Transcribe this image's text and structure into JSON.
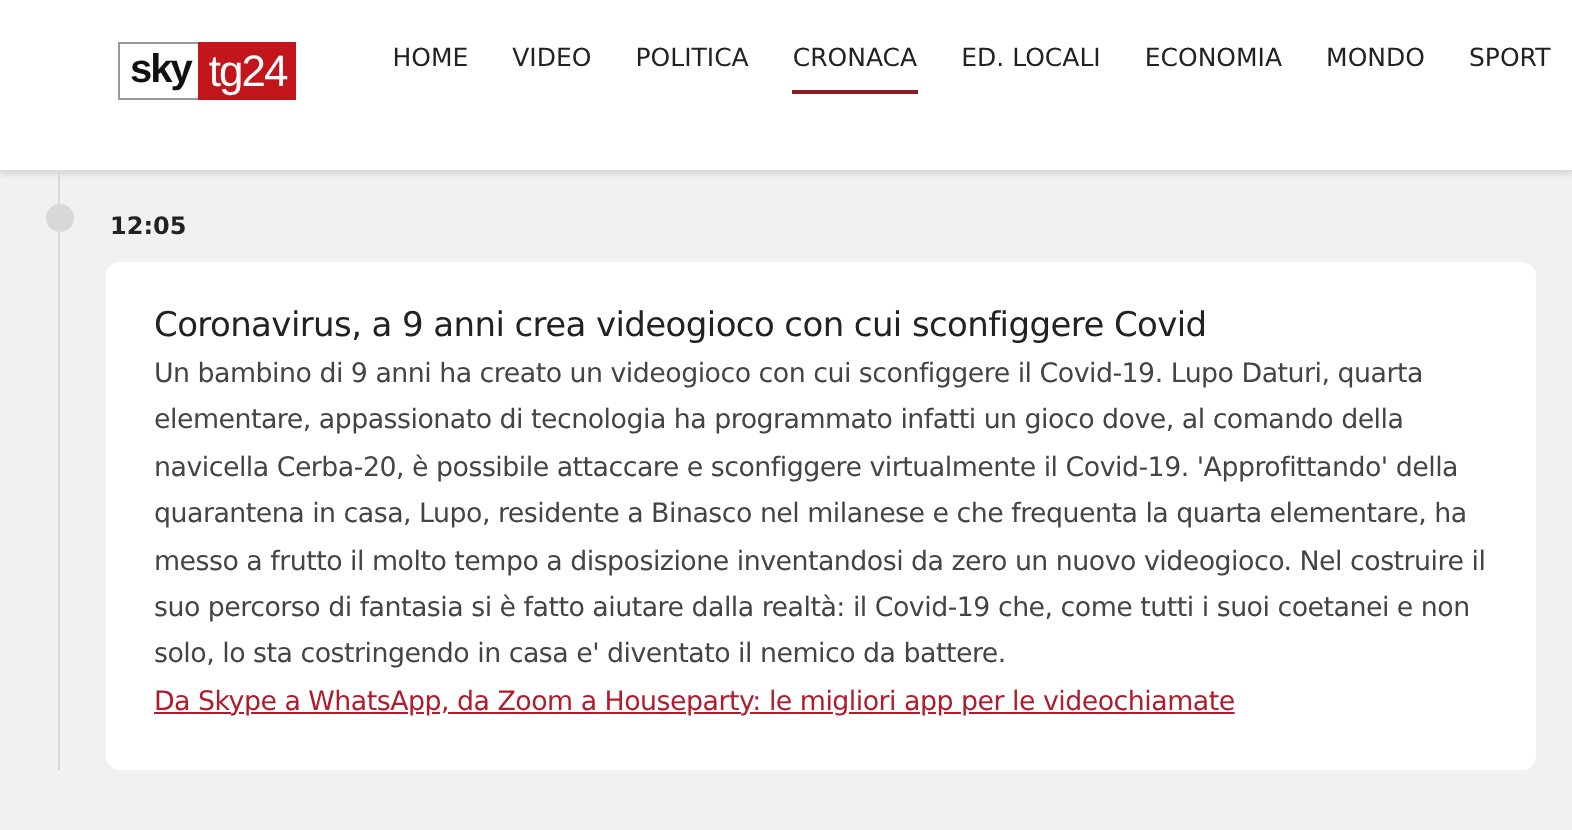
{
  "logo": {
    "brand": "sky",
    "channel": "tg24"
  },
  "nav": [
    {
      "label": "HOME",
      "selected": false
    },
    {
      "label": "VIDEO",
      "selected": false
    },
    {
      "label": "POLITICA",
      "selected": false
    },
    {
      "label": "CRONACA",
      "selected": true
    },
    {
      "label": "ED. LOCALI",
      "selected": false
    },
    {
      "label": "ECONOMIA",
      "selected": false
    },
    {
      "label": "MONDO",
      "selected": false
    },
    {
      "label": "SPORT",
      "selected": false
    }
  ],
  "entry": {
    "time": "12:05",
    "title": "Coronavirus, a 9 anni crea videogioco con cui sconfiggere Covid",
    "body": "Un bambino di 9 anni ha creato un videogioco con cui sconfiggere il Covid-19. Lupo Daturi, quarta elementare, appassionato di tecnologia ha programmato infatti un gioco dove, al comando della navicella Cerba-20, è possibile attaccare e sconfiggere virtualmente il Covid-19. 'Approfittando' della quarantena in casa, Lupo, residente a Binasco nel milanese e che frequenta la quarta elementare, ha messo a frutto il molto tempo a disposizione inventandosi da zero un nuovo videogioco. Nel costruire il suo percorso di fantasia si è fatto aiutare dalla realtà: il Covid-19 che, come tutti i suoi coetanei e non solo, lo sta costringendo in casa e' diventato il nemico da battere.",
    "link": "Da Skype a WhatsApp, da Zoom a Houseparty: le migliori app per le videochiamate"
  }
}
